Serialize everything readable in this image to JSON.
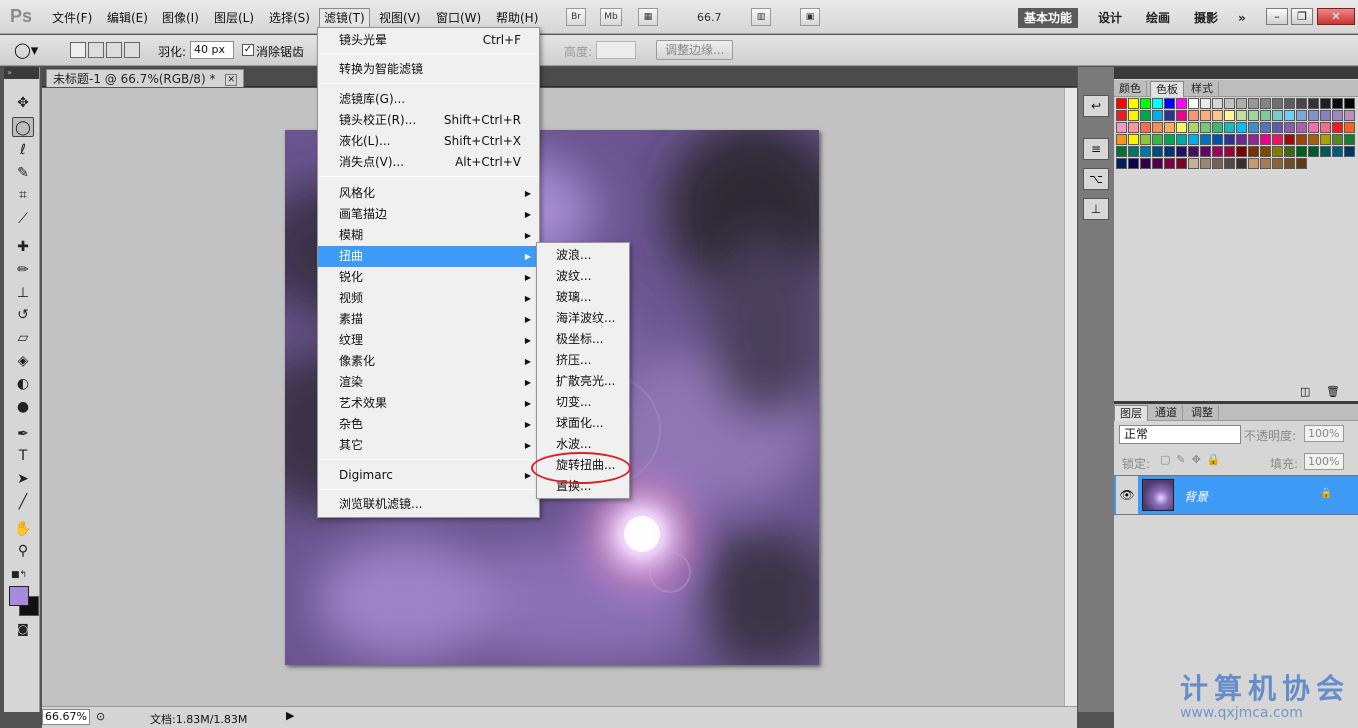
{
  "menubar": {
    "logo": "Ps",
    "items": [
      "文件(F)",
      "编辑(E)",
      "图像(I)",
      "图层(L)",
      "选择(S)",
      "滤镜(T)",
      "视图(V)",
      "窗口(W)",
      "帮助(H)"
    ],
    "bridge": "Br",
    "minibridge": "Mb",
    "zoom": "66.7",
    "workspaces": [
      "基本功能",
      "设计",
      "绘画",
      "摄影"
    ],
    "more": "»"
  },
  "options": {
    "feather_label": "羽化:",
    "feather_value": "40 px",
    "antialias_label": "消除锯齿",
    "height_label": "高度:",
    "refine_edge": "调整边缘..."
  },
  "document": {
    "tab_title": "未标题-1 @ 66.7%(RGB/8) *",
    "status_zoom": "66.67%",
    "status_info": "文档:1.83M/1.83M"
  },
  "filter_menu": {
    "items": [
      {
        "label": "镜头光晕",
        "shortcut": "Ctrl+F"
      },
      {
        "label": "转换为智能滤镜",
        "shortcut": ""
      },
      {
        "label": "滤镜库(G)...",
        "shortcut": ""
      },
      {
        "label": "镜头校正(R)...",
        "shortcut": "Shift+Ctrl+R"
      },
      {
        "label": "液化(L)...",
        "shortcut": "Shift+Ctrl+X"
      },
      {
        "label": "消失点(V)...",
        "shortcut": "Alt+Ctrl+V"
      },
      {
        "label": "风格化",
        "shortcut": ""
      },
      {
        "label": "画笔描边",
        "shortcut": ""
      },
      {
        "label": "模糊",
        "shortcut": ""
      },
      {
        "label": "扭曲",
        "shortcut": ""
      },
      {
        "label": "锐化",
        "shortcut": ""
      },
      {
        "label": "视频",
        "shortcut": ""
      },
      {
        "label": "素描",
        "shortcut": ""
      },
      {
        "label": "纹理",
        "shortcut": ""
      },
      {
        "label": "像素化",
        "shortcut": ""
      },
      {
        "label": "渲染",
        "shortcut": ""
      },
      {
        "label": "艺术效果",
        "shortcut": ""
      },
      {
        "label": "杂色",
        "shortcut": ""
      },
      {
        "label": "其它",
        "shortcut": ""
      },
      {
        "label": "Digimarc",
        "shortcut": ""
      },
      {
        "label": "浏览联机滤镜...",
        "shortcut": ""
      }
    ],
    "highlighted": "扭曲"
  },
  "distort_submenu": {
    "items": [
      "波浪...",
      "波纹...",
      "玻璃...",
      "海洋波纹...",
      "极坐标...",
      "挤压...",
      "扩散亮光...",
      "切变...",
      "球面化...",
      "水波...",
      "旋转扭曲...",
      "置换..."
    ],
    "circled": "旋转扭曲..."
  },
  "swatches_panel": {
    "tabs": [
      "颜色",
      "色板",
      "样式"
    ],
    "active_tab": "色板"
  },
  "layers_panel": {
    "tabs": [
      "图层",
      "通道",
      "调整"
    ],
    "active_tab": "图层",
    "blend_mode": "正常",
    "opacity_label": "不透明度:",
    "opacity_value": "100%",
    "lock_label": "锁定:",
    "fill_label": "填充:",
    "fill_value": "100%",
    "layer_name": "背景"
  },
  "watermark": {
    "text": "计算机协会",
    "url": "www.qxjmca.com"
  },
  "colors": {
    "highlight": "#3d9af5",
    "foreground": "#a88bd8",
    "circle": "#d8232a"
  }
}
